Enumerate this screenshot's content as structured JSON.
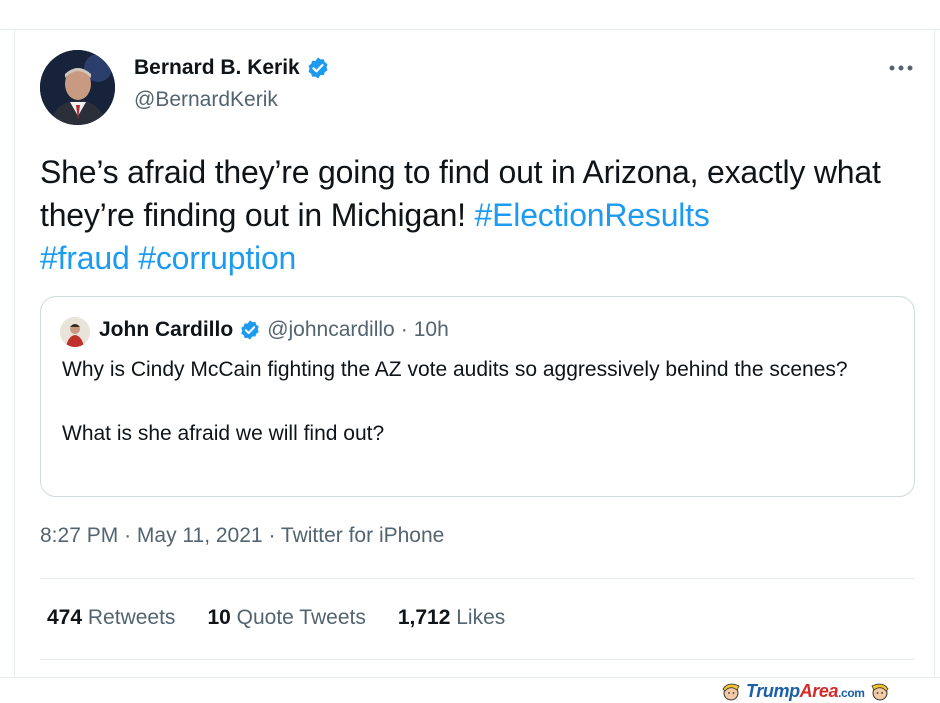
{
  "tweet": {
    "author": {
      "display_name": "Bernard B. Kerik",
      "handle": "@BernardKerik",
      "verified": true
    },
    "text_plain": "She’s afraid they’re going to find out in Arizona, exactly what they’re finding out in Michigan! ",
    "hashtags": [
      "#ElectionResults",
      "#fraud",
      "#corruption"
    ],
    "quoted": {
      "author": {
        "display_name": "John Cardillo",
        "handle": "@johncardillo",
        "verified": true
      },
      "separator": "·",
      "age": "10h",
      "text_line1": "Why is Cindy McCain fighting the AZ vote audits so aggressively behind the scenes?",
      "text_line2": "What is she afraid we will find out?"
    },
    "time": "8:27 PM",
    "separator": "·",
    "date": "May 11, 2021",
    "source": "Twitter for iPhone",
    "stats": {
      "retweets_count": "474",
      "retweets_label": "Retweets",
      "quotes_count": "10",
      "quotes_label": "Quote Tweets",
      "likes_count": "1,712",
      "likes_label": "Likes"
    }
  },
  "watermark": {
    "trump": "Trump",
    "area": "Area",
    "com": ".com"
  },
  "colors": {
    "accent": "#1d9bf0",
    "text": "#0f1419",
    "secondary": "#536471",
    "border": "#cfd9de"
  },
  "icons": {
    "verified": "verified-badge-icon",
    "more": "more-options-icon"
  }
}
